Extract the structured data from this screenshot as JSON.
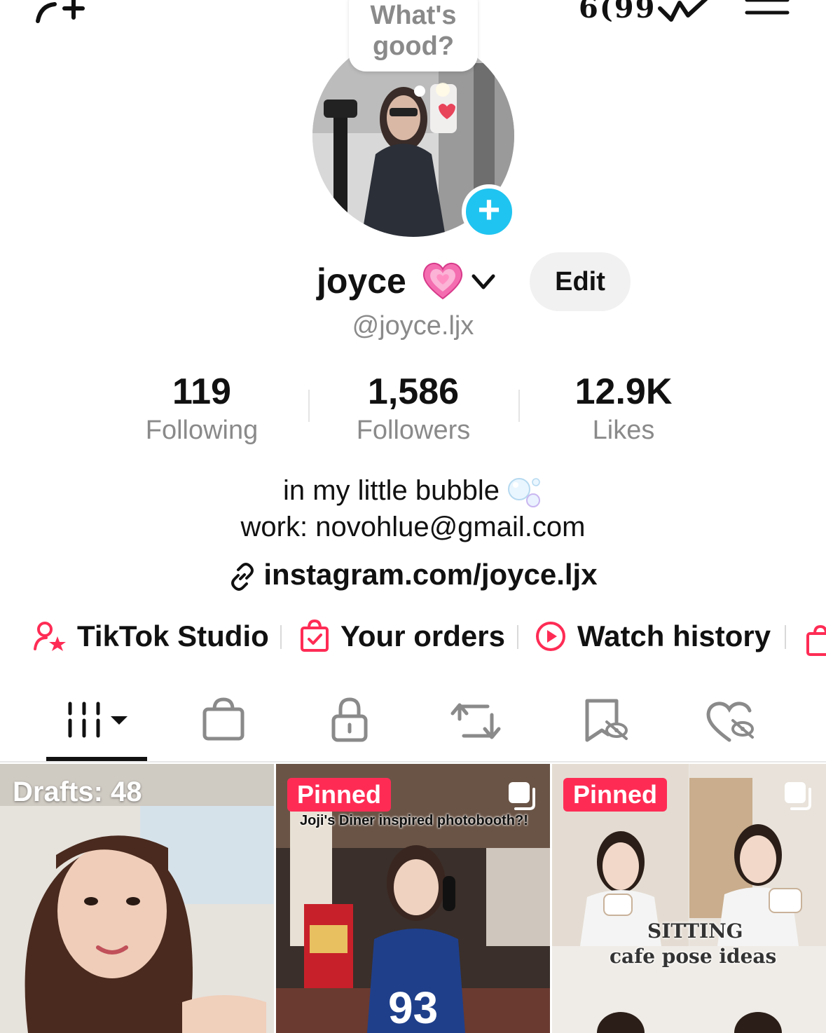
{
  "top_bar": {
    "add_friend_icon": "add-friend-icon",
    "counter_text": "6(99",
    "activity_icon": "activity-icon",
    "menu_icon": "menu-icon"
  },
  "avatar": {
    "note_text": "What's good?",
    "add_story_symbol": "+"
  },
  "profile": {
    "display_name": "joyce",
    "name_emoji": "pink-heart",
    "handle": "@joyce.ljx",
    "edit_label": "Edit"
  },
  "stats": {
    "following": {
      "value": "119",
      "label": "Following"
    },
    "followers": {
      "value": "1,586",
      "label": "Followers"
    },
    "likes": {
      "value": "12.9K",
      "label": "Likes"
    }
  },
  "bio": {
    "line1": "in my little bubble",
    "line2": "work: novohlue@gmail.com",
    "link": "instagram.com/joyce.ljx"
  },
  "quick_links": [
    {
      "label": "TikTok Studio",
      "icon": "studio-icon"
    },
    {
      "label": "Your orders",
      "icon": "orders-bag-icon"
    },
    {
      "label": "Watch history",
      "icon": "play-circle-icon"
    }
  ],
  "content_tabs": [
    {
      "name": "videos",
      "icon": "grid-videos-icon",
      "selected": true
    },
    {
      "name": "shop",
      "icon": "shopping-bag-icon",
      "selected": false
    },
    {
      "name": "private",
      "icon": "lock-icon",
      "selected": false
    },
    {
      "name": "reposts",
      "icon": "repost-icon",
      "selected": false
    },
    {
      "name": "favorites",
      "icon": "bookmark-hidden-icon",
      "selected": false
    },
    {
      "name": "liked",
      "icon": "heart-hidden-icon",
      "selected": false
    }
  ],
  "grid": [
    {
      "type": "drafts",
      "label": "Drafts: 48"
    },
    {
      "type": "post",
      "badge": "Pinned",
      "caption": "Joji's Diner inspired photobooth?!",
      "multi": true
    },
    {
      "type": "post",
      "badge": "Pinned",
      "caption_line1": "SITTING",
      "caption_line2": "cafe pose ideas",
      "multi": true
    }
  ],
  "colors": {
    "brand_red": "#fe2c55",
    "story_blue": "#20c4f0",
    "muted_text": "#8a8a8a"
  }
}
